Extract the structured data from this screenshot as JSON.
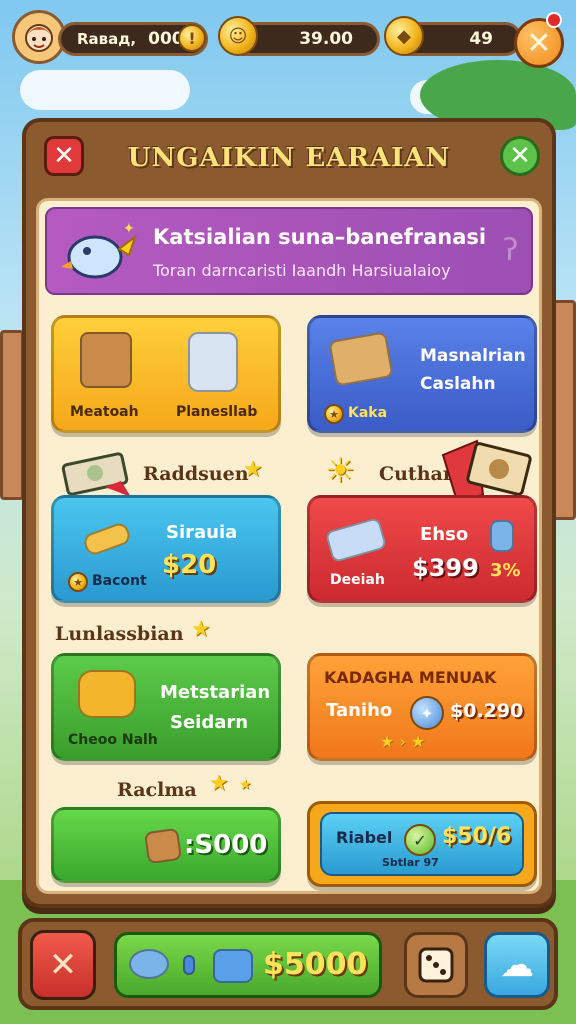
{
  "top_bar": {
    "player_name": "Raвад,",
    "player_score": "000",
    "coins": "39.00",
    "gems": "49"
  },
  "panel": {
    "title": "UNGAIKIN EARAIAN"
  },
  "banner": {
    "title": "Katsialian suna–banefranasi",
    "subtitle": "Toran darncaristi Iaandh Harsiualaioy"
  },
  "cards": {
    "card1": {
      "left_label": "Meatoah",
      "right_label": "Planesllab"
    },
    "card2": {
      "title": "Masnalrian",
      "subtitle": "Caslahn",
      "tag": "Kaka"
    },
    "section1": "Raddsuen",
    "card3": {
      "title": "Sirauia",
      "price": "$20",
      "tag": "Bacont"
    },
    "section2": "Cuthar",
    "card4": {
      "title": "Ehso",
      "price": "$399",
      "tag": "Deeiah",
      "percent": "3%"
    },
    "section3": "Lunlassbian",
    "card5": {
      "title": "Metstarian",
      "subtitle": "Seidarn",
      "tag": "Cheoo Nalh"
    },
    "card6": {
      "title": "KADAGHA MENUAK",
      "label": "Taniho",
      "price": "$0.290"
    },
    "section4": "Raclma",
    "card7": {
      "price": ":S000"
    },
    "card8": {
      "label": "Riabel",
      "price": "$50/6",
      "sub": "Sbtlar 97"
    }
  },
  "bottom_bar": {
    "total": "$5000"
  },
  "colors": {
    "wood": "#8b5a2e",
    "parchment": "#fbefcf",
    "banner_purple": "#b55ac0",
    "yellow_card": "#f5b322",
    "blue_card": "#4a6fd6",
    "cyan_card": "#36b2e0",
    "red_card": "#e0383c",
    "green_card": "#48b33a",
    "orange_card": "#f58a1e"
  }
}
